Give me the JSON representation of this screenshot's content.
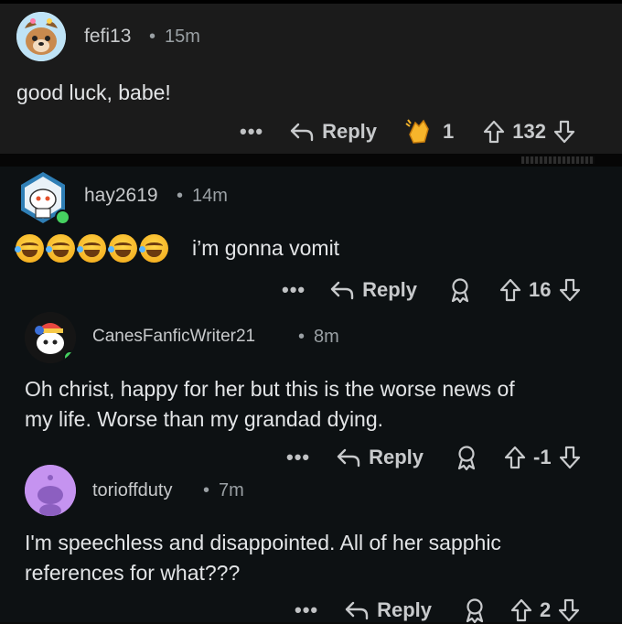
{
  "comments": [
    {
      "username": "fefi13",
      "separator": "•",
      "time": "15m",
      "text": "good luck, babe!",
      "more": "•••",
      "reply_label": "Reply",
      "award_count": "1",
      "score": "132"
    },
    {
      "username": "hay2619",
      "separator": "•",
      "time": "14m",
      "emoji_name": "laughing-crying-emoji",
      "emoji_count": 5,
      "text": "i’m gonna vomit",
      "more": "•••",
      "reply_label": "Reply",
      "score": "16"
    },
    {
      "username": "CanesFanficWriter21",
      "separator": "•",
      "time": "8m",
      "text_lines": [
        "Oh christ, happy for her but this is the worse news of",
        "my life. Worse than my grandad dying."
      ],
      "more": "•••",
      "reply_label": "Reply",
      "score": "-1"
    },
    {
      "username": "torioffduty",
      "separator": "•",
      "time": "7m",
      "text_lines": [
        "I'm speechless and disappointed. All of her sapphic",
        "references for what???"
      ],
      "more": "•••",
      "reply_label": "Reply",
      "score": "2"
    }
  ],
  "colors": {
    "top_panel": "#1b1b1b",
    "bottom_panel": "#0d1113",
    "text": "#e3e5e7",
    "muted": "#9aa0a4",
    "online": "#46d160",
    "avatar_purple": "#c593f0"
  },
  "icons": [
    "reply-arrow-icon",
    "upvote-icon",
    "downvote-icon",
    "award-icon",
    "clapping-award-icon"
  ]
}
